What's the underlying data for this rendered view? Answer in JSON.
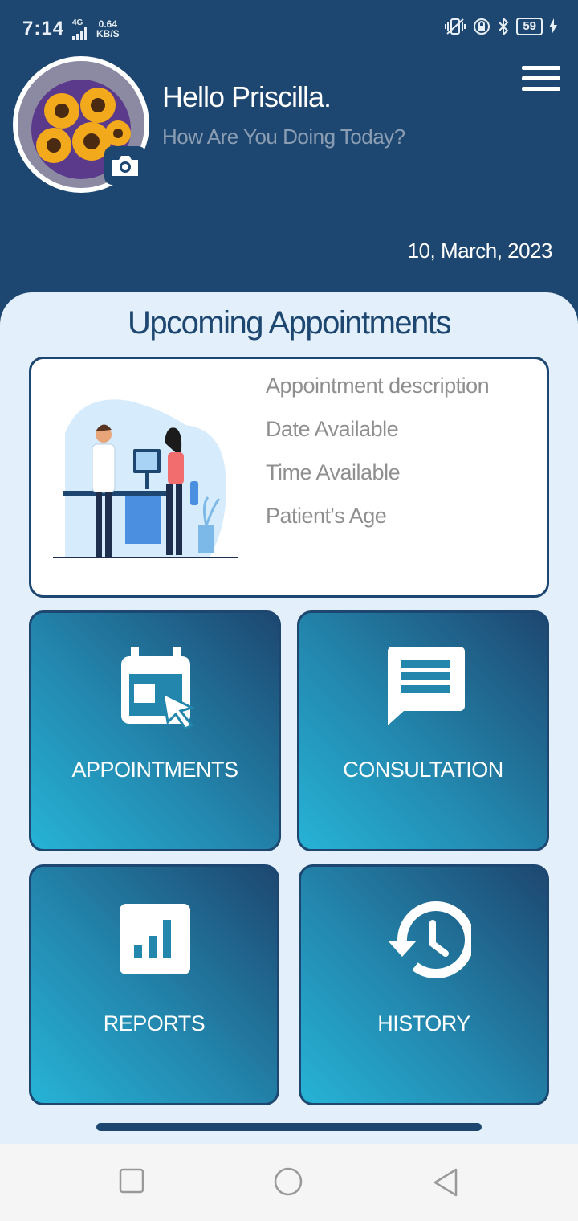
{
  "status_bar": {
    "time": "7:14",
    "network": "4G",
    "speed_value": "0.64",
    "speed_unit": "KB/S",
    "battery": "59"
  },
  "header": {
    "greeting": "Hello Priscilla.",
    "subtitle": "How Are You Doing Today?",
    "date": "10, March, 2023",
    "avatar_icon": "sunflower-photo",
    "camera_icon": "camera-icon",
    "menu_icon": "hamburger-menu-icon"
  },
  "appointments_section": {
    "title": "Upcoming Appointments",
    "illustration": "doctor-patient-illustration",
    "fields": [
      {
        "label": "Appointment description"
      },
      {
        "label": "Date Available"
      },
      {
        "label": "Time Available"
      },
      {
        "label": "Patient's Age"
      }
    ]
  },
  "tiles": [
    {
      "label": "APPOINTMENTS",
      "icon": "calendar-cursor-icon"
    },
    {
      "label": "CONSULTATION",
      "icon": "chat-bubble-icon"
    },
    {
      "label": "REPORTS",
      "icon": "bar-chart-icon"
    },
    {
      "label": "HISTORY",
      "icon": "history-clock-icon"
    }
  ],
  "colors": {
    "primary": "#1d4770",
    "accent": "#26b3d6",
    "panel_background": "#e3f0fb",
    "muted_text": "#8f8f8f"
  },
  "nav_bar": {
    "buttons": [
      "recent-apps",
      "home",
      "back"
    ]
  }
}
